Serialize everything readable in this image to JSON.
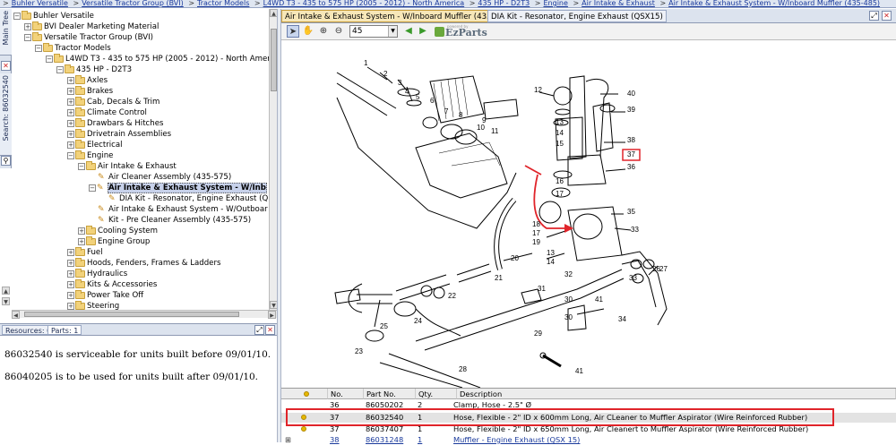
{
  "breadcrumb": [
    "Buhler Versatile",
    "Versatile Tractor Group (BVI)",
    "Tractor Models",
    "L4WD T3 - 435 to 575 HP (2005 - 2012) - North America",
    "435 HP - D2T3",
    "Engine",
    "Air Intake & Exhaust",
    "Air Intake & Exhaust System - W/Inboard Muffler (435-485)"
  ],
  "breadcrumb_separator": ">",
  "side_tabs": {
    "main_tree": "Main Tree",
    "search": "Search: 86032540"
  },
  "tree": [
    {
      "label": "Buhler Versatile"
    },
    {
      "label": "BVI Dealer Marketing Material"
    },
    {
      "label": "Versatile Tractor Group (BVI)"
    },
    {
      "label": "Tractor Models"
    },
    {
      "label": "L4WD T3 - 435 to 575 HP (2005 - 2012) - North Amer"
    },
    {
      "label": "435 HP - D2T3"
    },
    {
      "label": "Axles"
    },
    {
      "label": "Brakes"
    },
    {
      "label": "Cab, Decals & Trim"
    },
    {
      "label": "Climate Control"
    },
    {
      "label": "Drawbars & Hitches"
    },
    {
      "label": "Drivetrain Assemblies"
    },
    {
      "label": "Electrical"
    },
    {
      "label": "Engine"
    },
    {
      "label": "Air Intake & Exhaust"
    },
    {
      "label": "Air Cleaner Assembly (435-575)"
    },
    {
      "label": "Air Intake & Exhaust System - W/Inb"
    },
    {
      "label": "DIA Kit - Resonator, Engine Exhaust (Q"
    },
    {
      "label": "Air Intake & Exhaust System - W/Outboar"
    },
    {
      "label": "Kit - Pre Cleaner Assembly (435-575)"
    },
    {
      "label": "Cooling System"
    },
    {
      "label": "Engine Group"
    },
    {
      "label": "Fuel"
    },
    {
      "label": "Hoods, Fenders, Frames & Ladders"
    },
    {
      "label": "Hydraulics"
    },
    {
      "label": "Kits & Accessories"
    },
    {
      "label": "Power Take Off"
    },
    {
      "label": "Steering"
    }
  ],
  "lower_tabs": {
    "resources": "Resources: 0",
    "parts": "Parts: 1"
  },
  "notes": [
    "86032540 is serviceable for units built before 09/01/10.",
    "86040205 is to be used for units built after 09/01/10."
  ],
  "doc_tabs": [
    "Air Intake & Exhaust System - W/Inboard Muffler (435-485)",
    "DIA Kit - Resonator, Engine Exhaust (QSX15)"
  ],
  "toolbar": {
    "zoom_value": "45",
    "brand_small": "powered by",
    "brand_name": "EzParts"
  },
  "callouts": [
    "1",
    "2",
    "3",
    "4",
    "5",
    "6",
    "7",
    "8",
    "9",
    "10",
    "11",
    "12",
    "13",
    "14",
    "15",
    "16",
    "17",
    "18",
    "17",
    "19",
    "13",
    "14",
    "20",
    "21",
    "22",
    "23",
    "24",
    "25",
    "26",
    "27",
    "28",
    "29",
    "30",
    "31",
    "32",
    "33",
    "34",
    "35",
    "36",
    "37",
    "38",
    "39",
    "40",
    "41",
    "30",
    "33",
    "41"
  ],
  "highlighted_callout": "37",
  "grid": {
    "headers": {
      "no": "No.",
      "part": "Part No.",
      "qty": "Qty.",
      "desc": "Description"
    },
    "rows": [
      {
        "no": "36",
        "part": "86050202",
        "qty": "2",
        "desc": "Clamp, Hose - 2.5\" Ø",
        "selected": false,
        "link": false
      },
      {
        "no": "37",
        "part": "86032540",
        "qty": "1",
        "desc": "Hose, Flexible - 2\" ID x 600mm Long, Air CLeaner to Muffler Aspirator (Wire Reinforced Rubber)",
        "selected": true,
        "link": false
      },
      {
        "no": "37",
        "part": "86037407",
        "qty": "1",
        "desc": "Hose, Flexible - 2\" ID x 650mm Long, Air Cleanert to Muffler Aspirator (Wire Reinforced Rubber)",
        "selected": false,
        "link": false
      },
      {
        "no": "38",
        "part": "86031248",
        "qty": "1",
        "desc": "Muffler - Engine Exhaust (QSX 15)",
        "selected": false,
        "link": true
      }
    ]
  },
  "colors": {
    "accent_red": "#e0242a",
    "tab_active": "#f7e7b8",
    "link": "#1a3a9c"
  }
}
